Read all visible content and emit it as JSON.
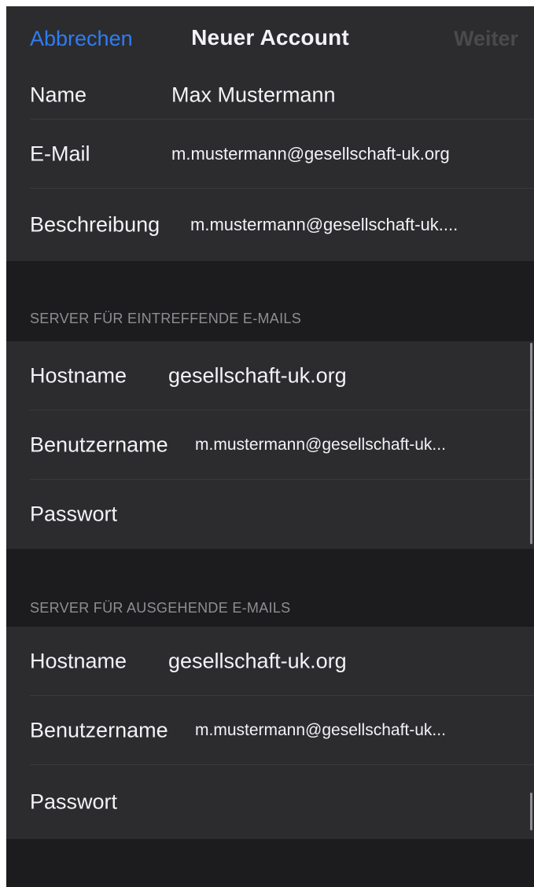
{
  "navbar": {
    "cancel_label": "Abbrechen",
    "title": "Neuer Account",
    "next_label": "Weiter"
  },
  "account": {
    "name_label": "Name",
    "name_value": "Max Mustermann",
    "email_label": "E-Mail",
    "email_value": "m.mustermann@gesellschaft-uk.org",
    "description_label": "Beschreibung",
    "description_value": "m.mustermann@gesellschaft-uk...."
  },
  "incoming": {
    "header": "SERVER FÜR EINTREFFENDE E-MAILS",
    "hostname_label": "Hostname",
    "hostname_value": "gesellschaft-uk.org",
    "username_label": "Benutzername",
    "username_value": "m.mustermann@gesellschaft-uk...",
    "password_label": "Passwort"
  },
  "outgoing": {
    "header": "SERVER FÜR AUSGEHENDE E-MAILS",
    "hostname_label": "Hostname",
    "hostname_value": "gesellschaft-uk.org",
    "username_label": "Benutzername",
    "username_value": "m.mustermann@gesellschaft-uk...",
    "password_label": "Passwort"
  },
  "colors": {
    "accent": "#2e7cf6",
    "background": "#1c1c1e",
    "cell": "#2c2c2e",
    "secondary_text": "#8e8e93"
  }
}
